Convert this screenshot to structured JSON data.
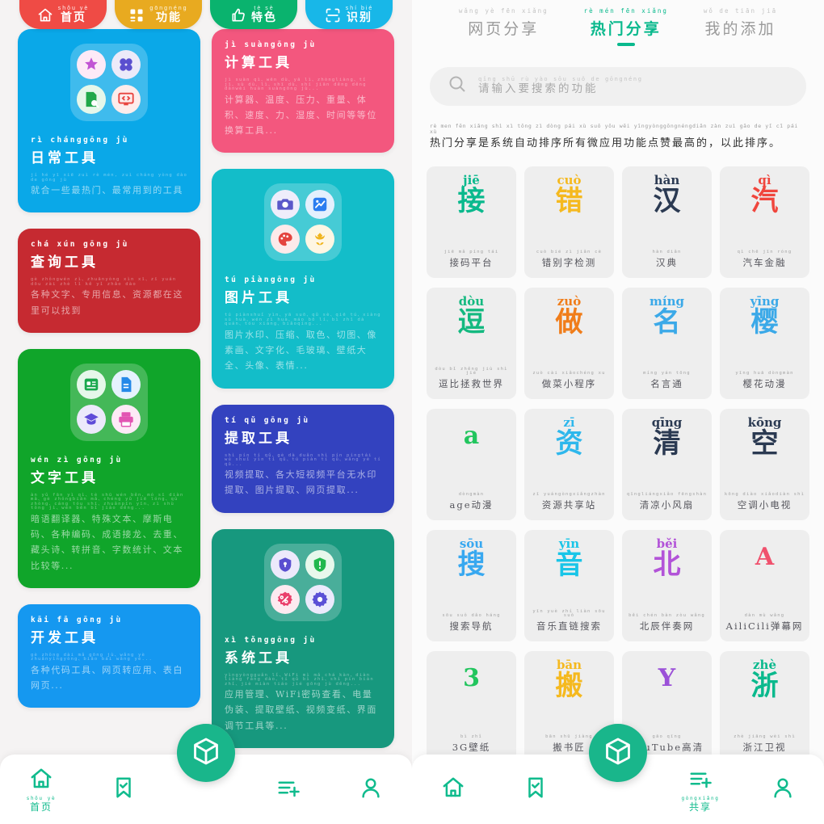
{
  "left_panel": {
    "top_tabs": [
      {
        "pinyin": "shǒu yè",
        "label": "首页",
        "color": "#ef4b45",
        "icon": "home-icon"
      },
      {
        "pinyin": "gōngnéng",
        "label": "功能",
        "color": "#e8aa20",
        "icon": "grid-icon"
      },
      {
        "pinyin": "tè sè",
        "label": "特色",
        "color": "#0ab36e",
        "icon": "thumbs-up-icon"
      },
      {
        "pinyin": "shí bié",
        "label": "识别",
        "color": "#18b7e8",
        "icon": "scan-icon"
      }
    ],
    "cards_left": [
      {
        "pinyin": "rì chánggōng jù",
        "title": "日常工具",
        "desc_pinyin": "jí hé yī xiē zuì rè mén, zuì cháng yòng dào de gōng jù",
        "desc": "就合一些最热门、最常用到的工具",
        "color": "#0aa8e8",
        "has_icons": true,
        "icons": [
          "star-icon",
          "clover-icon",
          "doc-search-icon",
          "code-monitor-icon"
        ]
      },
      {
        "pinyin": "chá xún gōng jù",
        "title": "查询工具",
        "desc_pinyin": "gè zhǒngwén zì、zhuānyòng xìn xī、zī yuán dōu zài zhè lǐ kě yǐ zhǎo dào",
        "desc": "各种文字、专用信息、资源都在这里可以找到",
        "color": "#c62a31",
        "has_icons": false,
        "icons": []
      },
      {
        "pinyin": "wén zì gōng jù",
        "title": "文字工具",
        "desc_pinyin": "àn yǔ fān yì qì、tè shū wén běn、mó sī diàn mǎ、gè zhǒngbiān mǎ、chéng yǔ jiē lóng、qù zhòng、cáng tóu shī、zhuǎnpīn yīn、zì shù tǒng jì、wén běn bǐ jiào děng...",
        "desc": "暗语翻译器、特殊文本、摩斯电码、各种编码、成语接龙、去重、藏头诗、转拼音、字数统计、文本比较等...",
        "color": "#10a52a",
        "has_icons": true,
        "icons": [
          "id-card-icon",
          "document-icon",
          "graduation-icon",
          "print-icon"
        ]
      },
      {
        "pinyin": "kāi fā gōng jù",
        "title": "开发工具",
        "desc_pinyin": "gè zhǒng dài mǎ gōng jù、wǎng yè zhuǎnyìngyòng、biǎo bái wǎng yè...",
        "desc": "各种代码工具、网页转应用、表白网页...",
        "color": "#1598f0",
        "has_icons": false,
        "icons": []
      }
    ],
    "cards_right": [
      {
        "pinyin": "jì suàngōng jù",
        "title": "计算工具",
        "desc_pinyin": "jì suàn qì、wēn dù、yā lì、zhòngliàng、tǐ jī、sù dù、lì、shī dù、shí jiān děng děng dānwèi huàn suàngōng jù...",
        "desc": "计算器、温度、压力、重量、体积、速度、力、湿度、时间等等位换算工具...",
        "color": "#f3577e",
        "has_icons": false,
        "icons": []
      },
      {
        "pinyin": "tú piàngōng jù",
        "title": "图片工具",
        "desc_pinyin": "tú piànshuǐ yìn、yā suō、qǔ sè、qiē tú、xiàng sù huà、wén zì huà、máo bō lí、bì zhǐ dà quán、tóu xiàng、biǎoqíng...",
        "desc": "图片水印、压缩、取色、切图、像素画、文字化、毛玻璃、壁纸大全、头像、表情...",
        "color": "#13bdc9",
        "has_icons": true,
        "icons": [
          "camera-icon",
          "photo-chart-icon",
          "palette-icon",
          "tulip-icon"
        ]
      },
      {
        "pinyin": "tí qǔ gōng jù",
        "title": "提取工具",
        "desc_pinyin": "shì pín tí qǔ、gè dà duǎn shì pín píngtái wú shuǐ yìn tí qǔ、tú piàn tí qǔ、wǎng yè tí qǔ...",
        "desc": "视频提取、各大短视频平台无水印提取、图片提取、网页提取...",
        "color": "#3342bf",
        "has_icons": false,
        "icons": []
      },
      {
        "pinyin": "xì tǒnggōng jù",
        "title": "系统工具",
        "desc_pinyin": "yìngyòngguǎn lǐ、WiFi mì mǎ chá kàn、diàn liàng fáng dào、tí qǔ bì zhǐ、shì pín biàn zhǐ、jiè miàn tiáo jié gōng jù děng...",
        "desc": "应用管理、WiFi密码查看、电量伪装、提取壁纸、视频变纸、界面调节工具等...",
        "color": "#17987e",
        "has_icons": true,
        "icons": [
          "lock-shield-icon",
          "shield-alert-icon",
          "discount-icon",
          "gear-icon"
        ]
      }
    ],
    "bottom_nav": [
      {
        "icon": "home-icon",
        "pinyin": "shǒu yè",
        "label": "首页",
        "active": true
      },
      {
        "icon": "bookmark-check-icon",
        "pinyin": "",
        "label": "",
        "active": false
      },
      {
        "icon": "share-add-icon",
        "pinyin": "",
        "label": "",
        "active": false
      },
      {
        "icon": "person-icon",
        "pinyin": "",
        "label": "",
        "active": false
      }
    ],
    "fab_icon": "cube-icon"
  },
  "right_panel": {
    "tabs": [
      {
        "pinyin": "wǎng yè fēn xiǎng",
        "label": "网页分享",
        "active": false
      },
      {
        "pinyin": "rè mén fēn xiǎng",
        "label": "热门分享",
        "active": true
      },
      {
        "pinyin": "wǒ de tiān jiā",
        "label": "我的添加",
        "active": false
      }
    ],
    "search": {
      "icon": "search-icon",
      "placeholder_pinyin": "qǐng shū rù yào sōu suǒ de gōngnéng",
      "placeholder": "请输入要搜索的功能"
    },
    "notice": {
      "pinyin": "rè men fēn xiǎng shì  xì tǒng zì dòng pái  xù suǒ yǒu wēi yīngyònggōngnéngdiǎn zàn zuì gāo de     yǐ  cǐ  pái xù",
      "text": "热门分享是系统自动排序所有微应用功能点赞最高的，以此排序。"
    },
    "grid_items": [
      {
        "pinyin": "jiē",
        "char": "接",
        "color": "#0ab98d",
        "sub_pinyin": "jiē mǎ píng tái",
        "sub": "接码平台"
      },
      {
        "pinyin": "cuò",
        "char": "错",
        "color": "#f5b91f",
        "sub_pinyin": "cuò bié zì jiǎn cè",
        "sub": "错别字检测"
      },
      {
        "pinyin": "hàn",
        "char": "汉",
        "color": "#2b3a52",
        "sub_pinyin": "hàn diǎn",
        "sub": "汉典"
      },
      {
        "pinyin": "qì",
        "char": "汽",
        "color": "#f0463d",
        "sub_pinyin": "qì chē jīn róng",
        "sub": "汽车金融"
      },
      {
        "pinyin": "dòu",
        "char": "逗",
        "color": "#14b980",
        "sub_pinyin": "dòu bǐ zhěng jiù shì jiè",
        "sub": "逗比拯救世界"
      },
      {
        "pinyin": "zuò",
        "char": "做",
        "color": "#f07d1a",
        "sub_pinyin": "zuò cài xiǎochéng xu",
        "sub": "做菜小程序"
      },
      {
        "pinyin": "míng",
        "char": "名",
        "color": "#3ba9e8",
        "sub_pinyin": "míng yán tōng",
        "sub": "名言通"
      },
      {
        "pinyin": "yīng",
        "char": "樱",
        "color": "#3ba9e8",
        "sub_pinyin": "yīng huā dòngmàn",
        "sub": "樱花动漫"
      },
      {
        "pinyin": "",
        "char": "a",
        "color": "#22c55e",
        "sub_pinyin": "dòngmàn",
        "sub": "age动漫"
      },
      {
        "pinyin": "zī",
        "char": "资",
        "color": "#2eb7ec",
        "sub_pinyin": "zī yuángòngxiǎngzhàn",
        "sub": "资源共享站"
      },
      {
        "pinyin": "qīng",
        "char": "清",
        "color": "#2b3a52",
        "sub_pinyin": "qīngliángxiǎo fēngshàn",
        "sub": "清凉小风扇"
      },
      {
        "pinyin": "kōng",
        "char": "空",
        "color": "#2b3a52",
        "sub_pinyin": "kōng diào xiǎodiàn shì",
        "sub": "空调小电视"
      },
      {
        "pinyin": "sōu",
        "char": "搜",
        "color": "#38a8f0",
        "sub_pinyin": "sōu suǒ dǎo háng",
        "sub": "搜索导航"
      },
      {
        "pinyin": "yīn",
        "char": "音",
        "color": "#19c5e8",
        "sub_pinyin": "yīn yuè zhí liàn sōu suǒ",
        "sub": "音乐直链搜索"
      },
      {
        "pinyin": "běi",
        "char": "北",
        "color": "#b253d8",
        "sub_pinyin": "běi chén bàn zòu wǎng",
        "sub": "北辰伴奏网"
      },
      {
        "pinyin": "",
        "char": "A",
        "color": "#f0516d",
        "sub_pinyin": "dàn mù wǎng",
        "sub": "AiliCili弹幕网"
      },
      {
        "pinyin": "",
        "char": "3",
        "color": "#22c55e",
        "sub_pinyin": "bì zhǐ",
        "sub": "3G壁纸"
      },
      {
        "pinyin": "bān",
        "char": "搬",
        "color": "#f5b91f",
        "sub_pinyin": "bān shū jiàng",
        "sub": "搬书匠"
      },
      {
        "pinyin": "",
        "char": "Y",
        "color": "#9b51d8",
        "sub_pinyin": "gāo qīng",
        "sub": "YouTube高清"
      },
      {
        "pinyin": "zhè",
        "char": "浙",
        "color": "#0ab98d",
        "sub_pinyin": "zhè jiāng wèi shì",
        "sub": "浙江卫视"
      }
    ],
    "bottom_nav": [
      {
        "icon": "home-icon",
        "pinyin": "",
        "label": "",
        "active": false
      },
      {
        "icon": "bookmark-check-icon",
        "pinyin": "",
        "label": "",
        "active": false
      },
      {
        "icon": "share-add-icon",
        "pinyin": "gòngxiǎng",
        "label": "共享",
        "active": true
      },
      {
        "icon": "person-icon",
        "pinyin": "",
        "label": "",
        "active": false
      }
    ],
    "fab_icon": "cube-icon"
  }
}
